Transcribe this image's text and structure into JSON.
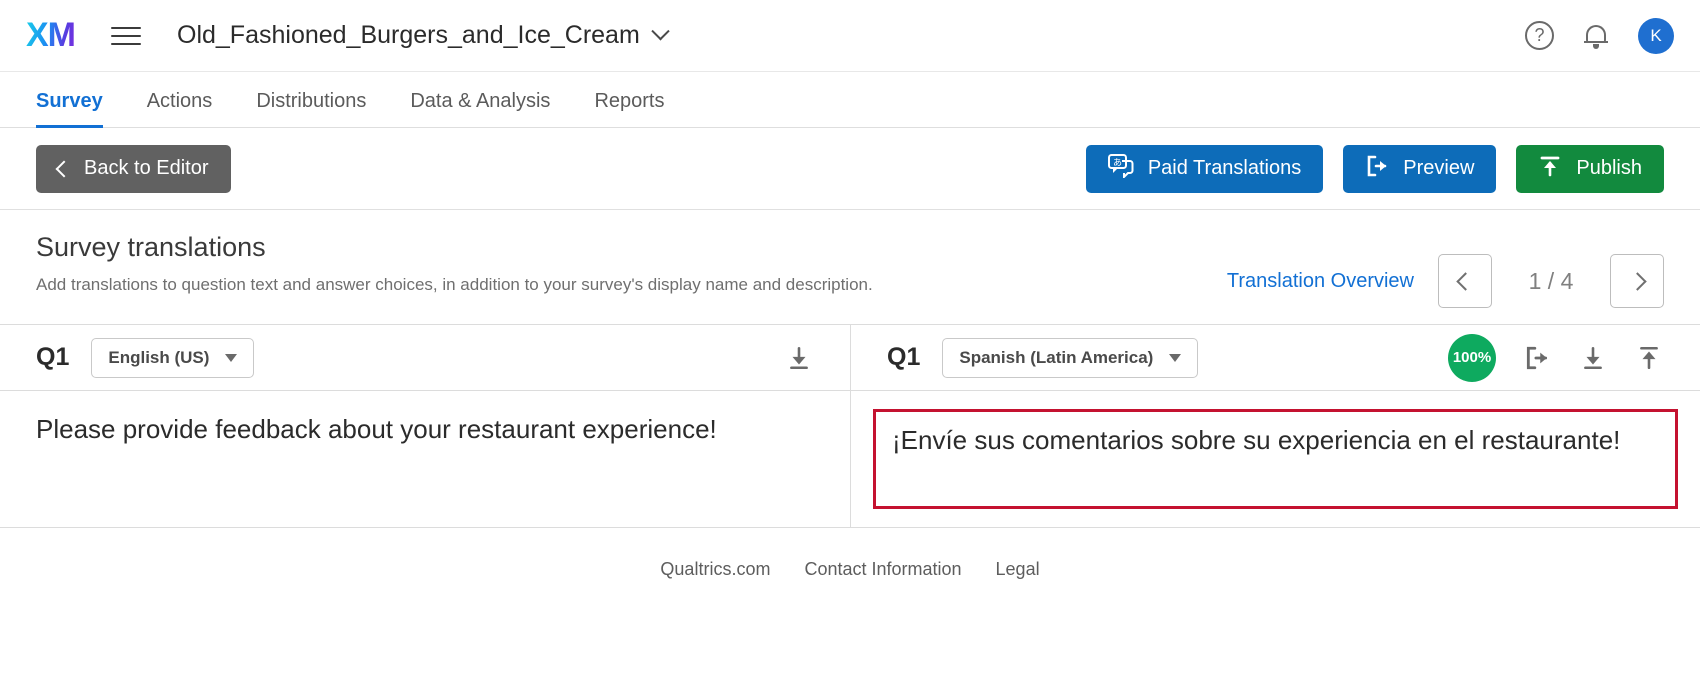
{
  "topbar": {
    "logo_text": "XM",
    "menu_icon": "hamburger-menu-icon",
    "survey_name": "Old_Fashioned_Burgers_and_Ice_Cream",
    "help_label": "?",
    "avatar_initial": "K"
  },
  "tabs": [
    {
      "label": "Survey",
      "active": true
    },
    {
      "label": "Actions",
      "active": false
    },
    {
      "label": "Distributions",
      "active": false
    },
    {
      "label": "Data & Analysis",
      "active": false
    },
    {
      "label": "Reports",
      "active": false
    }
  ],
  "toolbar": {
    "back_label": "Back to Editor",
    "paid_translations_label": "Paid Translations",
    "preview_label": "Preview",
    "publish_label": "Publish"
  },
  "section": {
    "title": "Survey translations",
    "description": "Add translations to question text and answer choices, in addition to your survey's display name and description.",
    "overview_link": "Translation Overview",
    "page_indicator": "1 / 4"
  },
  "translation": {
    "source": {
      "question_id": "Q1",
      "language": "English (US)",
      "text": "Please provide feedback about your restaurant experience!"
    },
    "target": {
      "question_id": "Q1",
      "language": "Spanish (Latin America)",
      "percent": "100%",
      "text": "¡Envíe sus comentarios sobre su experiencia en el restaurante!"
    }
  },
  "footer": {
    "links": [
      "Qualtrics.com",
      "Contact Information",
      "Legal"
    ]
  },
  "colors": {
    "accent_blue": "#1270d4",
    "button_blue": "#0d6cb9",
    "publish_green": "#128a3e",
    "badge_green": "#0eaa5f",
    "highlight_red": "#c41230",
    "back_gray": "#616161"
  }
}
